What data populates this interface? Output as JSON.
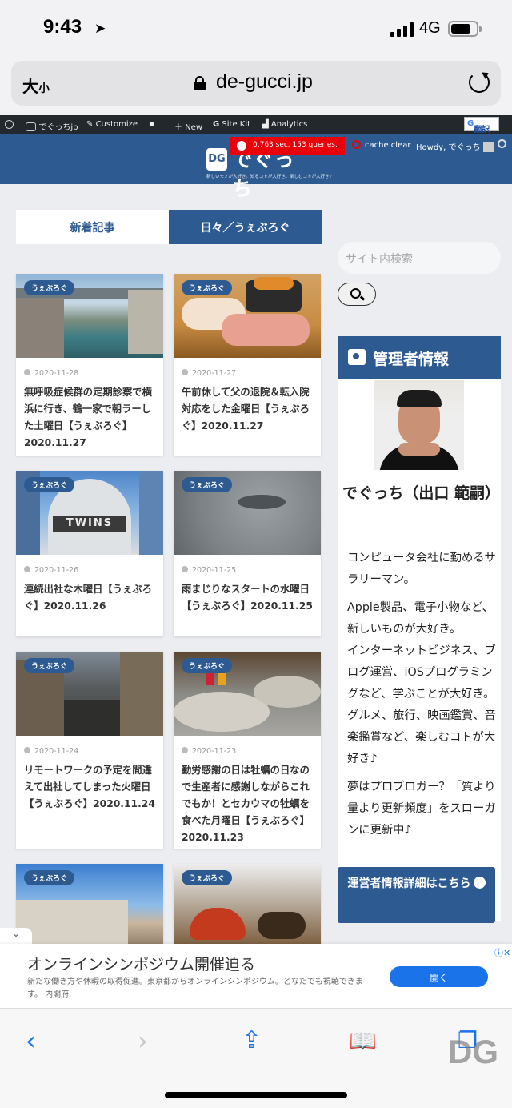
{
  "status": {
    "time": "9:43",
    "network": "4G"
  },
  "browser": {
    "text_size": "大",
    "text_size_small": "小",
    "url": "de-gucci.jp"
  },
  "admin_bar": {
    "site": "でぐっちjp",
    "customize": "Customize",
    "new": "New",
    "site_kit": "Site Kit",
    "analytics": "Analytics",
    "translate": "翻訳"
  },
  "site_header": {
    "perf": "0.763 sec. 153 queries.",
    "logo_mark": "DG",
    "logo_name": "でぐっち",
    "tagline": "新しいモノが大好き。知るコトが大好き。楽しむコトが大好き♪",
    "cache_clear": "cache clear",
    "howdy": "Howdy, でぐっち"
  },
  "tabs": [
    "新着記事",
    "日々／うぇぶろぐ"
  ],
  "posts": [
    {
      "category": "うぇぶろぐ",
      "date": "2020-11-28",
      "title": "無呼吸症候群の定期診察で横浜に行き、鶴一家で朝ラーした土曜日【うぇぶろぐ】2020.11.27"
    },
    {
      "category": "うぇぶろぐ",
      "date": "2020-11-27",
      "title": "午前休して父の退院＆転入院対応をした金曜日【うぇぶろぐ】2020.11.27"
    },
    {
      "category": "うぇぶろぐ",
      "date": "2020-11-26",
      "title": "連続出社な木曜日【うぇぶろぐ】2020.11.26"
    },
    {
      "category": "うぇぶろぐ",
      "date": "2020-11-25",
      "title": "雨まじりなスタートの水曜日【うぇぶろぐ】2020.11.25"
    },
    {
      "category": "うぇぶろぐ",
      "date": "2020-11-24",
      "title": "リモートワークの予定を間違えて出社してしまった火曜日【うぇぶろぐ】2020.11.24"
    },
    {
      "category": "うぇぶろぐ",
      "date": "2020-11-23",
      "title": "勤労感謝の日は牡蠣の日なので生産者に感謝しながらこれでもか！とセカウマの牡蠣を食べた月曜日【うぇぶろぐ】2020.11.23"
    },
    {
      "category": "うぇぶろぐ",
      "date": "",
      "title": ""
    },
    {
      "category": "うぇぶろぐ",
      "date": "",
      "title": ""
    }
  ],
  "thumb_texts": {
    "twins": "TWINS"
  },
  "sidebar": {
    "search_placeholder": "サイト内検索",
    "admin_title": "管理者情報",
    "admin_name": "でぐっち（出口 範嗣）",
    "bio": [
      "コンピュータ会社に勤めるサラリーマン。",
      "Apple製品、電子小物など、新しいものが大好き。",
      "インターネットビジネス、ブログ運営、iOSプログラミングなど、学ぶことが大好き。",
      "グルメ、旅行、映画鑑賞、音楽鑑賞など、楽しむコトが大好き♪",
      "夢はプロブロガー？「質より量より更新頻度」をスローガンに更新中♪"
    ],
    "detail_button": "運営者情報詳細はこちら"
  },
  "ad": {
    "title": "オンラインシンポジウム開催迫る",
    "description": "新たな働き方や休暇の取得促進。東京都からオンラインシンポジウム。どなたでも視聴できます。 内閣府",
    "button": "開く"
  },
  "watermark": "DG"
}
